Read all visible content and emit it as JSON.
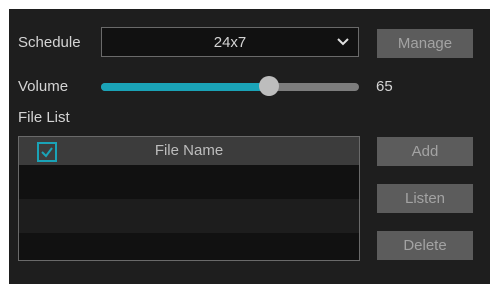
{
  "schedule": {
    "label": "Schedule",
    "selected": "24x7",
    "manage_label": "Manage"
  },
  "volume": {
    "label": "Volume",
    "value": 65,
    "value_text": "65"
  },
  "file_list": {
    "title": "File List",
    "column_header": "File Name",
    "header_checked": true,
    "rows": []
  },
  "actions": {
    "add_label": "Add",
    "listen_label": "Listen",
    "delete_label": "Delete"
  },
  "colors": {
    "accent": "#1aa3b7",
    "panel_bg": "#1e1e1e",
    "button_bg": "#5c5c5c"
  },
  "icons": {
    "dropdown": "chevron-down-icon",
    "header_checkbox": "check-icon"
  }
}
